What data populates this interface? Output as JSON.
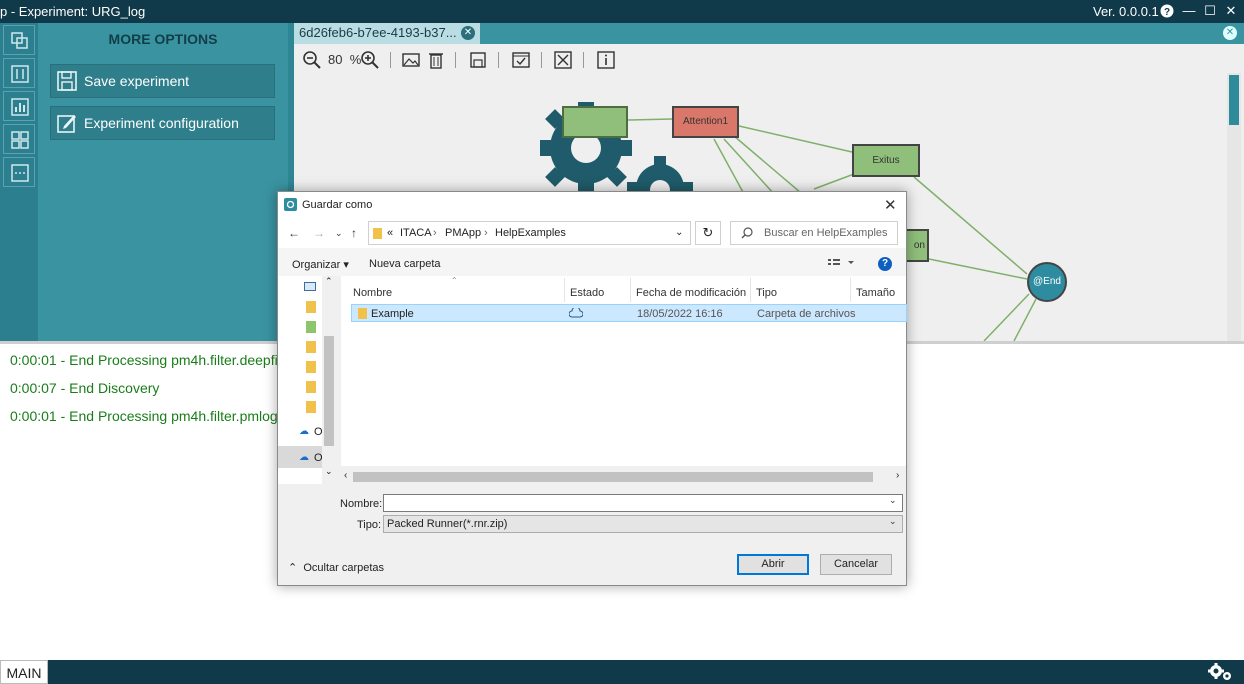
{
  "window": {
    "title": "p - Experiment: URG_log",
    "version": "Ver. 0.0.0.1"
  },
  "options": {
    "header": "MORE OPTIONS",
    "save": "Save experiment",
    "config": "Experiment configuration"
  },
  "canvas": {
    "tab_label": "6d26feb6-b7ee-4193-b37...",
    "zoom_value": "80",
    "zoom_unit": "%",
    "nodes": {
      "attention": "Attention1",
      "exitus": "Exitus",
      "partial": "on",
      "end": "@End"
    }
  },
  "log": {
    "lines": [
      "0:00:01 - End Processing pm4h.filter.deepfilter",
      "0:00:07 - End Discovery",
      "0:00:01 - End Processing pm4h.filter.pmlogfilt"
    ]
  },
  "status": {
    "main_tab": "MAIN"
  },
  "dialog": {
    "title": "Guardar como",
    "path": [
      "«",
      "ITACA",
      "PMApp",
      "HelpExamples"
    ],
    "search_placeholder": "Buscar en HelpExamples",
    "organize": "Organizar ▾",
    "new_folder": "Nueva carpeta",
    "columns": [
      "Nombre",
      "Estado",
      "Fecha de modificación",
      "Tipo",
      "Tamaño"
    ],
    "rows": [
      {
        "name": "Example",
        "date": "18/05/2022 16:16",
        "type": "Carpeta de archivos"
      }
    ],
    "nav_letters": [
      "O",
      "O"
    ],
    "nombre_label": "Nombre:",
    "nombre_value": "",
    "tipo_label": "Tipo:",
    "tipo_value": "Packed Runner(*.rnr.zip)",
    "hide_folders": "Ocultar carpetas",
    "open": "Abrir",
    "cancel": "Cancelar"
  },
  "colors": {
    "titlebar": "#103a4a",
    "panel": "#3a93a1",
    "node_green": "#8fbf7a",
    "node_red": "#d9776a",
    "end_node": "#2d8ca0",
    "log_text": "#1a7d1a"
  }
}
